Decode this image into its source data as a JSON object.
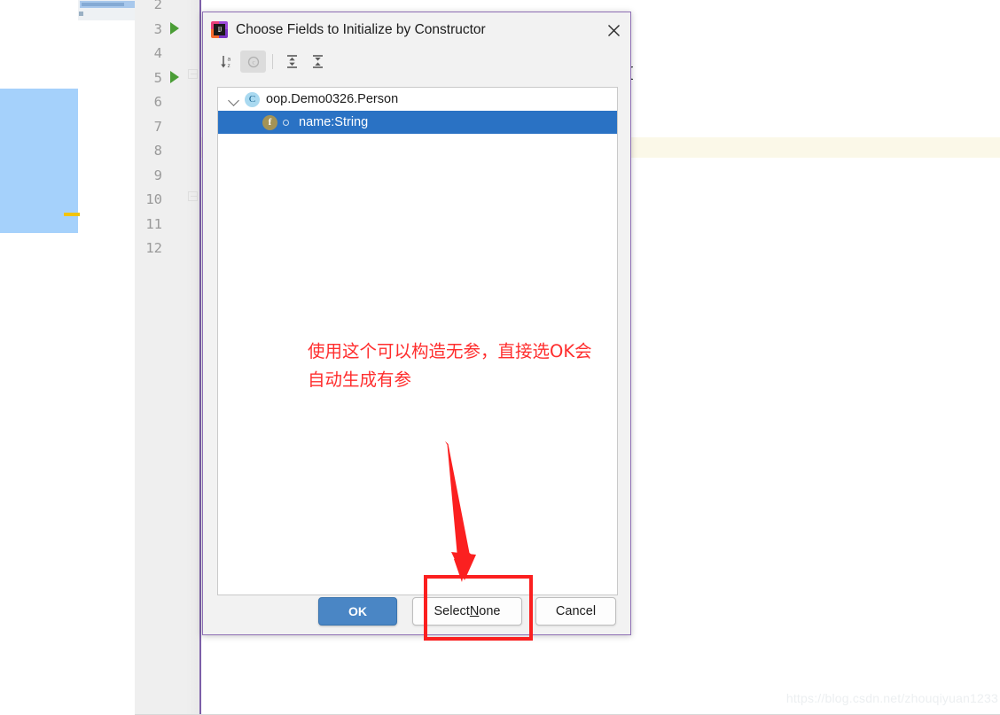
{
  "editor": {
    "line_numbers": [
      "2",
      "3",
      "4",
      "5",
      "6",
      "7",
      "8",
      "9",
      "10",
      "11",
      "12"
    ],
    "run_marker_lines": [
      "3",
      "5"
    ],
    "fold_marker_lines": [
      "5",
      "10"
    ],
    "code_fragment": "{",
    "highlighted_line": "8"
  },
  "dialog": {
    "title": "Choose Fields to Initialize by Constructor",
    "close_label": "Close",
    "toolbar": {
      "sort_alphabetically": "Sort alphabetically",
      "group_by_class": "Group by class",
      "expand_all": "Expand All",
      "collapse_all": "Collapse All"
    },
    "tree": {
      "class_node": {
        "label": "oop.Demo0326.Person",
        "badge": "C",
        "expanded": true
      },
      "fields": [
        {
          "label": "name:String",
          "badge": "f",
          "selected": true,
          "visibility": "private"
        }
      ]
    },
    "buttons": {
      "ok": "OK",
      "select_none_prefix": "Select ",
      "select_none_mnemonic": "N",
      "select_none_suffix": "one",
      "cancel": "Cancel"
    }
  },
  "annotation": {
    "note_text": "使用这个可以构造无参，直接选OK会\n自动生成有参",
    "note_color": "#ff2d2d",
    "highlight_target": "Select None",
    "highlight_color": "#fb1f1f"
  },
  "watermark": {
    "text": "https://blog.csdn.net/zhouqiyuan1233"
  }
}
